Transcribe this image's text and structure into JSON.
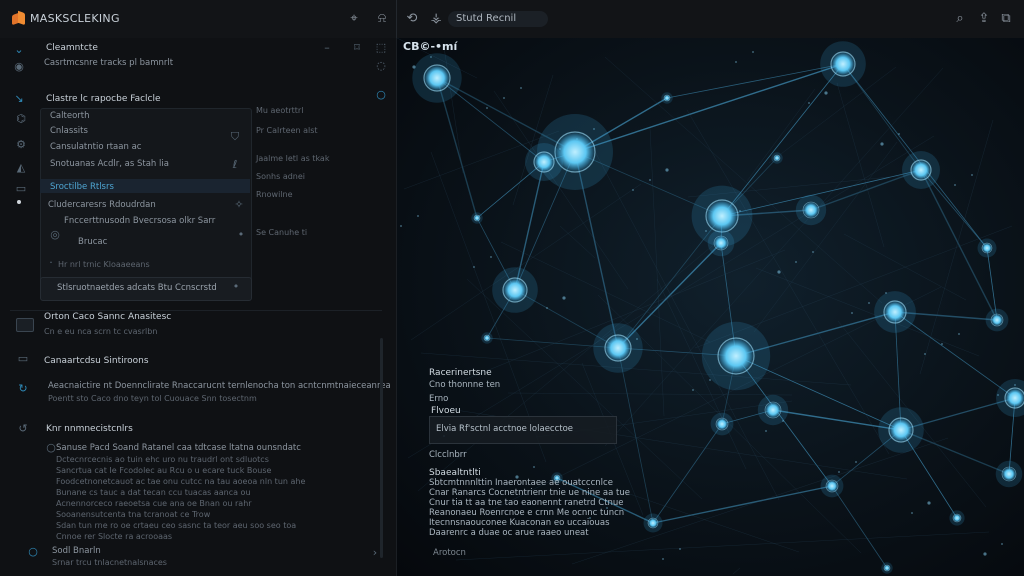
{
  "app": {
    "title": "MASKSCLEKING",
    "right_tab": "Stutd Recnil",
    "right_title": "CB©-•mí"
  },
  "topbar_icons": [
    "pin-icon",
    "bell-icon",
    "back-icon",
    "tree-icon",
    "search-icon",
    "share-icon",
    "copy-icon"
  ],
  "left": {
    "header": "Cleamntcte",
    "subheader": "Casrtmcsnre tracks pl bamnrlt",
    "section_title": "Clastre lc rapocbe Faclcle",
    "card_items": [
      "Calteorth",
      "Cnlassits",
      "Cansulatntio rtaan ac",
      "Snotuanas Acdlr, as Stah lia",
      "Sroctilbe Rtlsrs"
    ],
    "side_items": [
      "Mu aeotrttrl",
      "Pr Calrteen alst",
      "Jaalme letl as tkak",
      "Sonhs adnei",
      "Rnowilne",
      "Se Canuhe ti"
    ],
    "list_header": "Cludercaresrs Rdoudrdan",
    "list_item_a": "Fnccerttnusodn Bvecrsosa olkr Sarr",
    "list_item_a_sub": "Brucac",
    "list_item_b": "Hr nrl trnic Kloaaeeans",
    "run_button": "Stlsruotnaetdes adcats Btu Ccnscrstd",
    "section2_title": "Orton Caco Sannc Anasitesc",
    "section2_sub": "Cn e eu nca scrn tc cvasrlbn",
    "section3_title": "Canaartcdsu Sintiroons",
    "section3_lines": [
      "Aeacnaictire nt Doennclirate Rnaccarucnt ternlenocha ton acntcnmtnaieceanrea",
      "Poentt sto Caco dno teyn tol Cuouace Snn tosectnm"
    ],
    "section4_title": "Knr nnmnecistcnlrs",
    "section4_lines": [
      "Sanuse Pacd Soand Ratanel caa tdtcase ltatna ounsndatc",
      "Dctecnrcecnis ao tuin ehc uro nu traudrl ont sdluotcs",
      "Sancrtua cat Ie Fcodolec au Rcu o u ecare tuck Bouse",
      "Foodcetnonetcauot ac tae onu cutcc na tau aoeoa nln tun ahe",
      "Bunane cs tauc a dat tecan ccu tuacas aanca ou",
      "Acnennorceco raeoetsa cue ana oe Bnan ou rahr",
      "Sooanensutcenta tna tcranoat ce Trow",
      "Sdan tun rne ro oe crtaeu ceo sasnc ta teor aeu soo seo toa",
      "Cnnoe rer Slocte ra acrooaas"
    ],
    "footer_item": "Sodl Bnarln",
    "footer_sub": "Srnar trcu tnlacnetnalsnaces"
  },
  "right_overlay": {
    "label1": "Racerinertsne",
    "label1_sub": "Cno thonnne ten",
    "label2": "Flvoeu",
    "label2_sub": "Erno",
    "box_text": "Elvia Rf'sctnl acctnoe lolaecctoe",
    "label3": "Clcclnbrr",
    "label4": "Sbaealtntlti",
    "para": [
      "Sbtcmtnnnlttin Inaerontaee ae ouatcccnlce",
      "Cnar Ranarcs Cocnetntrienr tnie ue nine aa tue",
      "Cnur tia tt aa tne tao eaonennt ranetrd Ctnue",
      "Reanonaeu Roenrcnoe e crnn Me ocnnc tuncn",
      "Itecnnsnaouconee Kuaconan eo uccaiouas",
      "Daarenrc a duae oc arue raaeo uneat"
    ],
    "footer": "Arotocn"
  },
  "colors": {
    "accent": "#2f8ab8",
    "node": "#5cc7f2",
    "node_glow": "#3aa9e0",
    "edge": "#3f8fb8",
    "logo": "#e2742a"
  }
}
